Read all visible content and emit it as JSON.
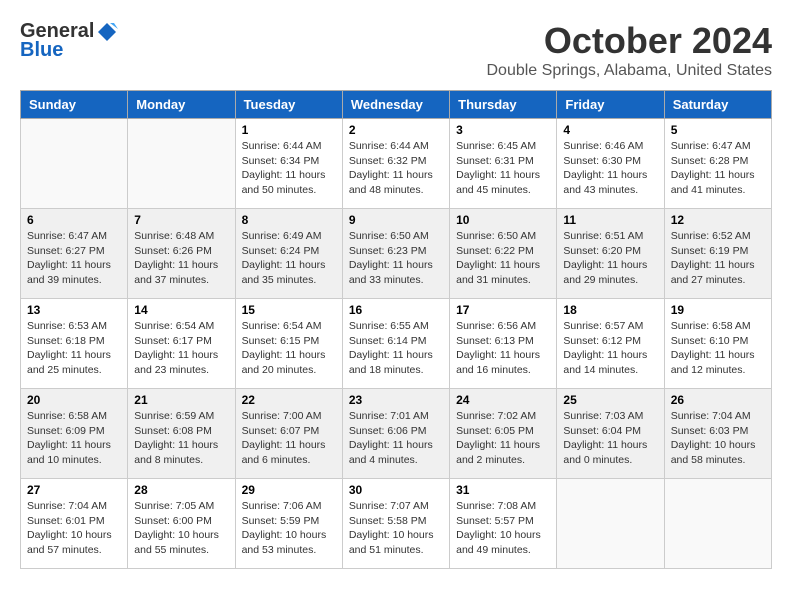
{
  "logo": {
    "general": "General",
    "blue": "Blue"
  },
  "title": "October 2024",
  "subtitle": "Double Springs, Alabama, United States",
  "weekdays": [
    "Sunday",
    "Monday",
    "Tuesday",
    "Wednesday",
    "Thursday",
    "Friday",
    "Saturday"
  ],
  "weeks": [
    [
      {
        "day": "",
        "details": ""
      },
      {
        "day": "",
        "details": ""
      },
      {
        "day": "1",
        "details": "Sunrise: 6:44 AM\nSunset: 6:34 PM\nDaylight: 11 hours and 50 minutes."
      },
      {
        "day": "2",
        "details": "Sunrise: 6:44 AM\nSunset: 6:32 PM\nDaylight: 11 hours and 48 minutes."
      },
      {
        "day": "3",
        "details": "Sunrise: 6:45 AM\nSunset: 6:31 PM\nDaylight: 11 hours and 45 minutes."
      },
      {
        "day": "4",
        "details": "Sunrise: 6:46 AM\nSunset: 6:30 PM\nDaylight: 11 hours and 43 minutes."
      },
      {
        "day": "5",
        "details": "Sunrise: 6:47 AM\nSunset: 6:28 PM\nDaylight: 11 hours and 41 minutes."
      }
    ],
    [
      {
        "day": "6",
        "details": "Sunrise: 6:47 AM\nSunset: 6:27 PM\nDaylight: 11 hours and 39 minutes."
      },
      {
        "day": "7",
        "details": "Sunrise: 6:48 AM\nSunset: 6:26 PM\nDaylight: 11 hours and 37 minutes."
      },
      {
        "day": "8",
        "details": "Sunrise: 6:49 AM\nSunset: 6:24 PM\nDaylight: 11 hours and 35 minutes."
      },
      {
        "day": "9",
        "details": "Sunrise: 6:50 AM\nSunset: 6:23 PM\nDaylight: 11 hours and 33 minutes."
      },
      {
        "day": "10",
        "details": "Sunrise: 6:50 AM\nSunset: 6:22 PM\nDaylight: 11 hours and 31 minutes."
      },
      {
        "day": "11",
        "details": "Sunrise: 6:51 AM\nSunset: 6:20 PM\nDaylight: 11 hours and 29 minutes."
      },
      {
        "day": "12",
        "details": "Sunrise: 6:52 AM\nSunset: 6:19 PM\nDaylight: 11 hours and 27 minutes."
      }
    ],
    [
      {
        "day": "13",
        "details": "Sunrise: 6:53 AM\nSunset: 6:18 PM\nDaylight: 11 hours and 25 minutes."
      },
      {
        "day": "14",
        "details": "Sunrise: 6:54 AM\nSunset: 6:17 PM\nDaylight: 11 hours and 23 minutes."
      },
      {
        "day": "15",
        "details": "Sunrise: 6:54 AM\nSunset: 6:15 PM\nDaylight: 11 hours and 20 minutes."
      },
      {
        "day": "16",
        "details": "Sunrise: 6:55 AM\nSunset: 6:14 PM\nDaylight: 11 hours and 18 minutes."
      },
      {
        "day": "17",
        "details": "Sunrise: 6:56 AM\nSunset: 6:13 PM\nDaylight: 11 hours and 16 minutes."
      },
      {
        "day": "18",
        "details": "Sunrise: 6:57 AM\nSunset: 6:12 PM\nDaylight: 11 hours and 14 minutes."
      },
      {
        "day": "19",
        "details": "Sunrise: 6:58 AM\nSunset: 6:10 PM\nDaylight: 11 hours and 12 minutes."
      }
    ],
    [
      {
        "day": "20",
        "details": "Sunrise: 6:58 AM\nSunset: 6:09 PM\nDaylight: 11 hours and 10 minutes."
      },
      {
        "day": "21",
        "details": "Sunrise: 6:59 AM\nSunset: 6:08 PM\nDaylight: 11 hours and 8 minutes."
      },
      {
        "day": "22",
        "details": "Sunrise: 7:00 AM\nSunset: 6:07 PM\nDaylight: 11 hours and 6 minutes."
      },
      {
        "day": "23",
        "details": "Sunrise: 7:01 AM\nSunset: 6:06 PM\nDaylight: 11 hours and 4 minutes."
      },
      {
        "day": "24",
        "details": "Sunrise: 7:02 AM\nSunset: 6:05 PM\nDaylight: 11 hours and 2 minutes."
      },
      {
        "day": "25",
        "details": "Sunrise: 7:03 AM\nSunset: 6:04 PM\nDaylight: 11 hours and 0 minutes."
      },
      {
        "day": "26",
        "details": "Sunrise: 7:04 AM\nSunset: 6:03 PM\nDaylight: 10 hours and 58 minutes."
      }
    ],
    [
      {
        "day": "27",
        "details": "Sunrise: 7:04 AM\nSunset: 6:01 PM\nDaylight: 10 hours and 57 minutes."
      },
      {
        "day": "28",
        "details": "Sunrise: 7:05 AM\nSunset: 6:00 PM\nDaylight: 10 hours and 55 minutes."
      },
      {
        "day": "29",
        "details": "Sunrise: 7:06 AM\nSunset: 5:59 PM\nDaylight: 10 hours and 53 minutes."
      },
      {
        "day": "30",
        "details": "Sunrise: 7:07 AM\nSunset: 5:58 PM\nDaylight: 10 hours and 51 minutes."
      },
      {
        "day": "31",
        "details": "Sunrise: 7:08 AM\nSunset: 5:57 PM\nDaylight: 10 hours and 49 minutes."
      },
      {
        "day": "",
        "details": ""
      },
      {
        "day": "",
        "details": ""
      }
    ]
  ]
}
